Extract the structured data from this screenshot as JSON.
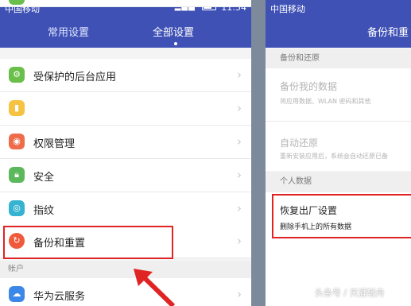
{
  "left_screen": {
    "status_bar": {
      "carrier": "中国移动",
      "time": "11:54"
    },
    "tabs": [
      {
        "label": "常用设置"
      },
      {
        "label": "全部设置",
        "active": true
      }
    ],
    "items": [
      {
        "label": "受保护的后台应用",
        "icon": "shield-app-icon",
        "color": "#6abf4b"
      },
      {
        "label": "",
        "icon": "battery-icon",
        "color": "#f5c242"
      },
      {
        "label": "权限管理",
        "icon": "permission-icon",
        "color": "#ef6c4a"
      },
      {
        "label": "安全",
        "icon": "lock-icon",
        "color": "#5cb85c"
      },
      {
        "label": "指纹",
        "icon": "fingerprint-icon",
        "color": "#35b3d1"
      },
      {
        "label": "备份和重置",
        "icon": "backup-icon",
        "color": "#ef5a3b",
        "highlighted": true
      },
      {
        "label": "华为云服务",
        "icon": "cloud-icon",
        "color": "#3b88e8"
      }
    ],
    "section_label": "帐户"
  },
  "right_screen": {
    "status_bar": {
      "carrier": "中国移动"
    },
    "title": "备份和重",
    "section_backup": "备份和还原",
    "backup_item": {
      "title": "备份我的数据",
      "subtitle": "将应用数据、WLAN 密码和其他"
    },
    "restore_item": {
      "title": "自动还原",
      "subtitle": "重新安装应用后，系统会自动还原已备"
    },
    "section_personal": "个人数据",
    "factory_item": {
      "title": "恢复出厂设置",
      "subtitle": "删除手机上的所有数据"
    }
  },
  "watermark": "头条号 / 天涯轻舟",
  "colors": {
    "header": "#3f51b5",
    "highlight": "#e02424"
  }
}
